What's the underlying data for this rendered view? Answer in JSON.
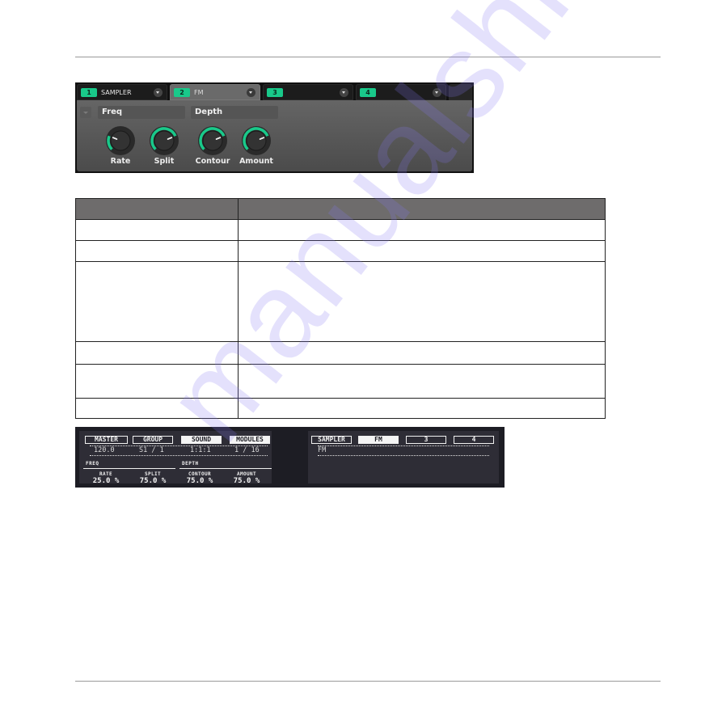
{
  "software_panel": {
    "slot_tabs": [
      {
        "number": "1",
        "label": "SAMPLER",
        "active": false
      },
      {
        "number": "2",
        "label": "FM",
        "active": true
      },
      {
        "number": "3",
        "label": "",
        "active": false
      },
      {
        "number": "4",
        "label": "",
        "active": false
      }
    ],
    "groups": [
      {
        "label": "Freq"
      },
      {
        "label": "Depth"
      }
    ],
    "knobs": [
      {
        "label": "Rate",
        "value_fraction": 0.25
      },
      {
        "label": "Split",
        "value_fraction": 0.75
      },
      {
        "label": "Contour",
        "value_fraction": 0.75
      },
      {
        "label": "Amount",
        "value_fraction": 0.75
      }
    ],
    "accent_color": "#19c98a"
  },
  "parameter_table": {
    "headers": [
      "",
      ""
    ],
    "rows": [
      [
        "",
        ""
      ],
      [
        "",
        ""
      ],
      [
        "",
        ""
      ],
      [
        "",
        ""
      ],
      [
        "",
        ""
      ],
      [
        "",
        ""
      ]
    ]
  },
  "hardware_display": {
    "left": {
      "tabs": [
        {
          "label": "MASTER",
          "on": false
        },
        {
          "label": "GROUP",
          "on": false
        },
        {
          "label": "SOUND",
          "on": true
        },
        {
          "label": "MODULES",
          "on": true
        }
      ],
      "values": [
        "120.0",
        "S1 / 1",
        "1:1:1",
        "1 / 16"
      ],
      "sections": [
        "FREQ",
        "DEPTH"
      ],
      "params": [
        {
          "name": "RATE",
          "value": "25.0 %"
        },
        {
          "name": "SPLIT",
          "value": "75.0 %"
        },
        {
          "name": "CONTOUR",
          "value": "75.0 %"
        },
        {
          "name": "AMOUNT",
          "value": "75.0 %"
        }
      ]
    },
    "right": {
      "tabs": [
        {
          "label": "SAMPLER",
          "on": false
        },
        {
          "label": "FM",
          "on": true
        },
        {
          "label": "3",
          "on": false
        },
        {
          "label": "4",
          "on": false
        }
      ],
      "value": "FM"
    }
  },
  "watermark": "manualshive.com"
}
